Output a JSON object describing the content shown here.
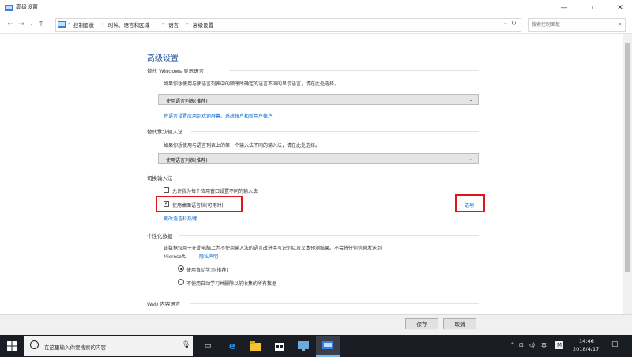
{
  "window": {
    "title": "高级设置",
    "minimize": "—",
    "maximize": "▫",
    "close": "✕"
  },
  "navbar": {
    "crumbs": [
      "控制面板",
      "时钟、语言和区域",
      "语言",
      "高级设置"
    ],
    "search_placeholder": "搜索控制面板",
    "icons": [
      "back-arrow-icon",
      "forward-arrow-icon",
      "chevron-down-icon",
      "up-arrow-icon",
      "control-panel-icon",
      "chevron-down-icon",
      "refresh-icon",
      "search-icon"
    ]
  },
  "page": {
    "title": "高级设置",
    "display_language": {
      "heading": "替代 Windows 显示语言",
      "desc": "如果你想使用与使语言列表中的顺序所确定的语言不同的显示语言，请在此处选择。",
      "select_value": "使用语言列表(推荐)",
      "link": "将语言设置应用到欢迎屏幕、系统帐户和新用户帐户"
    },
    "default_input": {
      "heading": "替代默认输入法",
      "desc": "如果你想使用与语言列表上的第一个输入法不同的输入法，请在此处选择。",
      "select_value": "使用语言列表(推荐)"
    },
    "switch_input": {
      "heading": "切换输入法",
      "option1": "允许我为每个应用窗口设置不同的输入法",
      "option2": "使用桌面语言栏(可用时)",
      "options_link": "选项",
      "hotkey_link": "更改语言栏热键"
    },
    "personalization": {
      "heading": "个性化数据",
      "desc_line1": "该数据仅用于在此电脑上为不使用输入法的语言改进手写识别以及文本预测结果。不会将任何信息发送到",
      "desc_line2": "Microsoft。",
      "privacy_link": "隐私声明",
      "radio1": "使用自动学习(推荐)",
      "radio2": "不使用自动学习并删除以前收集的所有数据"
    },
    "web_language": {
      "heading": "Web 内容语言"
    }
  },
  "footer": {
    "save": "保存",
    "cancel": "取消"
  },
  "taskbar": {
    "search_text": "在这里输入你要搜索的内容",
    "time": "14:46",
    "date": "2018/4/17",
    "ime_lang": "英",
    "ime_mode": "M"
  }
}
